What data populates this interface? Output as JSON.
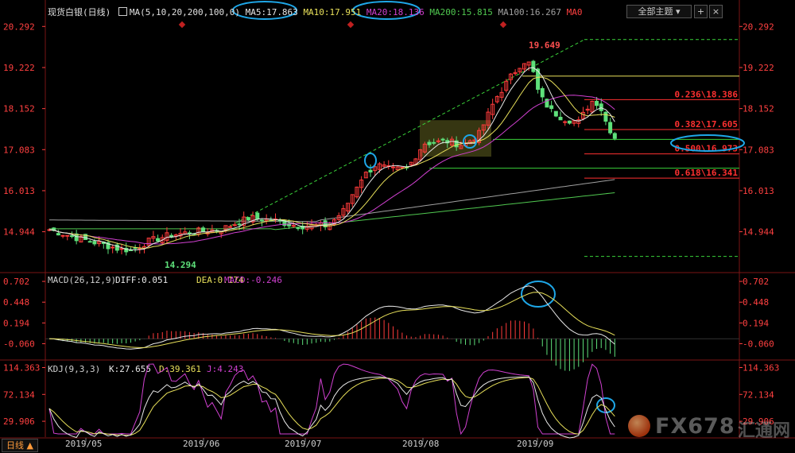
{
  "header": {
    "symbol_label": "现货白银(日线)",
    "ma_params": "MA(5,10,20,200,100,0)",
    "ma5": "MA5:17.863",
    "ma10": "MA10:17.951",
    "ma20": "MA20:18.136",
    "ma200": "MA200:15.815",
    "ma100": "MA100:16.267",
    "ma0": "MA0"
  },
  "toolbar": {
    "theme_dropdown": "全部主题",
    "period_button": "日线"
  },
  "watermark": {
    "brand": "FX678",
    "cn": "汇通网"
  },
  "colors": {
    "up": "#ff3b3b",
    "down": "#5ee07a",
    "ma5": "#e8e8e8",
    "ma10": "#e8e05a",
    "ma20": "#d040d0",
    "ma200": "#50c850",
    "ma100": "#a0a0a0",
    "fib_yellow": "#e8e05a",
    "fib_red": "#ff3030",
    "axis": "#ff4040",
    "circle": "#1ea7e8",
    "trend": "#3ad23a"
  },
  "chart_data": [
    {
      "type": "candlestick",
      "title": "现货白银(日线)",
      "ylim": [
        13.9,
        20.65
      ],
      "y_ticks": [
        20.292,
        19.222,
        18.152,
        17.083,
        16.013,
        14.944
      ],
      "y_tick_labels": [
        "20.292",
        "19.222",
        "18.152",
        "17.083",
        "16.013",
        "14.944"
      ],
      "x_ticks": [
        "2019/05",
        "2019/06",
        "2019/07",
        "2019/08",
        "2019/09"
      ],
      "annotations": [
        {
          "text": "19.649",
          "value": 19.649
        },
        {
          "text": "14.294",
          "value": 14.294
        }
      ],
      "fibonacci": [
        {
          "label": "0.236\\18.386",
          "value": 18.386
        },
        {
          "label": "0.382\\17.605",
          "value": 17.605
        },
        {
          "label": "0.500\\16.973",
          "value": 16.973
        },
        {
          "label": "0.618\\16.341",
          "value": 16.341
        }
      ],
      "series": [
        {
          "name": "MA5",
          "value": 17.863
        },
        {
          "name": "MA10",
          "value": 17.951
        },
        {
          "name": "MA20",
          "value": 18.136
        },
        {
          "name": "MA200",
          "value": 15.815
        },
        {
          "name": "MA100",
          "value": 16.267
        }
      ]
    },
    {
      "type": "line",
      "title": "MACD(26,12,9)",
      "diff_label": "DIFF:0.051",
      "dea_label": "DEA:0.174",
      "macd_label": "MACD:-0.246",
      "ylim": [
        -0.25,
        0.8
      ],
      "y_ticks": [
        0.702,
        0.448,
        0.194,
        -0.06
      ],
      "y_tick_labels": [
        "0.702",
        "0.448",
        "0.194",
        "-0.060"
      ]
    },
    {
      "type": "line",
      "title": "KDJ(9,3,3)",
      "k_label": "K:27.655",
      "d_label": "D:39.361",
      "j_label": "J:4.243",
      "ylim": [
        5,
        125
      ],
      "y_ticks": [
        114.363,
        72.134,
        29.906
      ],
      "y_tick_labels": [
        "114.363",
        "72.134",
        "29.906"
      ]
    }
  ]
}
